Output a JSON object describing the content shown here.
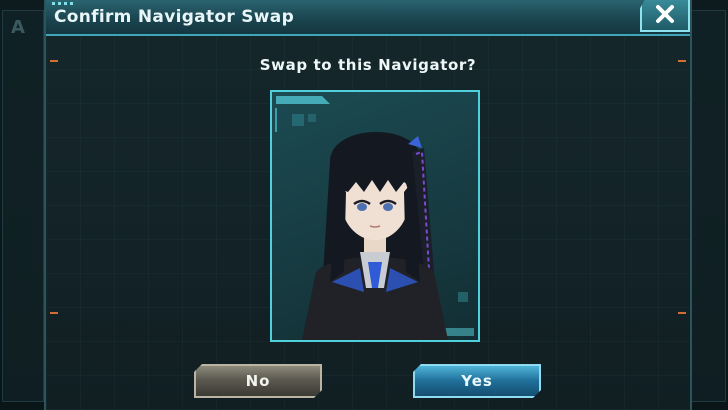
{
  "background": {
    "ghost_letter": "A"
  },
  "dialog": {
    "title": "Confirm Navigator Swap",
    "close_icon": "close-x-icon",
    "prompt": "Swap to this Navigator?",
    "portrait": {
      "description_icon": "navigator-portrait"
    },
    "buttons": {
      "no_label": "No",
      "yes_label": "Yes"
    }
  },
  "colors": {
    "accent_cyan": "#4fd0dc",
    "title_bar": "#1b4550",
    "yes_button": "#1f6f99",
    "no_button": "#5c5a50",
    "edge_marks": "#d07030"
  }
}
